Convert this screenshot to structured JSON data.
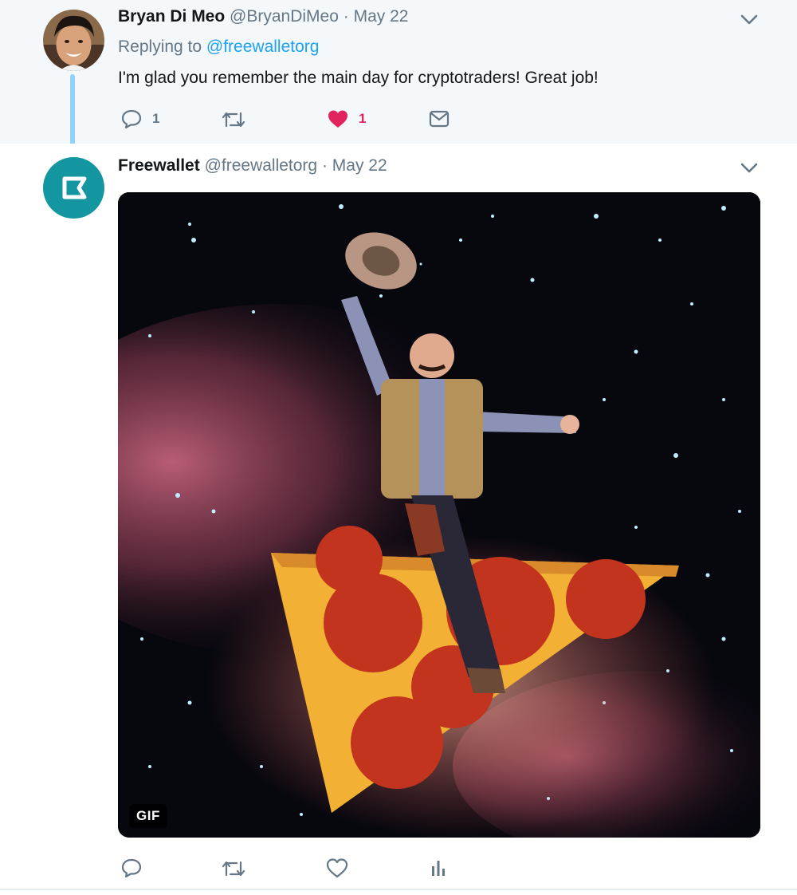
{
  "reply_tweet": {
    "author_name": "Bryan Di Meo",
    "author_handle": "@BryanDiMeo",
    "separator": "·",
    "date": "May 22",
    "replying_to_prefix": "Replying to",
    "replying_to_handle": "@freewalletorg",
    "text": "I'm glad you remember the main day for cryptotraders! Great job!",
    "actions": {
      "reply_count": "1",
      "retweet_count": "",
      "like_count": "1",
      "liked": true
    }
  },
  "main_tweet": {
    "author_name": "Freewallet",
    "author_handle": "@freewalletorg",
    "separator": "·",
    "date": "May 22",
    "media": {
      "type": "gif",
      "badge": "GIF",
      "subject": "cowboy riding a pepperoni pizza slice through a starry nebula"
    },
    "actions": {
      "reply_count": "",
      "retweet_count": "",
      "like_count": ""
    }
  },
  "icons": [
    "reply-icon",
    "retweet-icon",
    "like-icon",
    "message-icon",
    "analytics-icon",
    "chevron-down-icon",
    "freewallet-logo-icon"
  ],
  "colors": {
    "accent_link": "#1da1f2",
    "like_active": "#e0245e",
    "muted_text": "#657786",
    "reply_background": "#f5f8fa",
    "thread_line": "#8fd3fb",
    "freewallet_brand": "#1496a1"
  }
}
